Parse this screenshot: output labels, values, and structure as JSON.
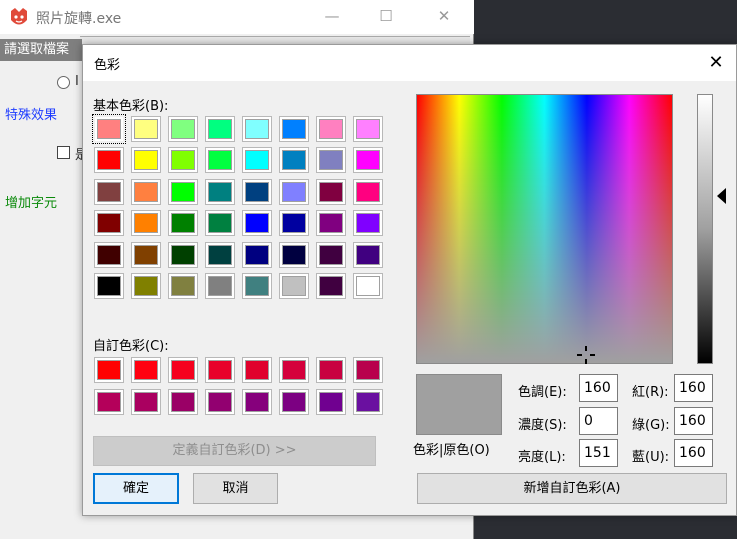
{
  "app": {
    "title": "照片旋轉.exe",
    "browse_label": "請選取檔案",
    "special_effects_label": "特殊效果",
    "add_text_label": "增加字元",
    "radio_label_partial": "I",
    "checkbox_label_partial": "是"
  },
  "dialog": {
    "title": "色彩",
    "basic_colors_label": "基本色彩(B):",
    "custom_colors_label": "自訂色彩(C):",
    "define_custom_button": "定義自訂色彩(D) >>",
    "ok_button": "確定",
    "cancel_button": "取消",
    "add_custom_button": "新增自訂色彩(A)",
    "preview_label": "色彩|原色(O)",
    "hue_label": "色調(E):",
    "hue_value": "160",
    "sat_label": "濃度(S):",
    "sat_value": "0",
    "lum_label": "亮度(L):",
    "lum_value": "151",
    "red_label": "紅(R):",
    "red_value": "160",
    "green_label": "綠(G):",
    "green_value": "160",
    "blue_label": "藍(U):",
    "blue_value": "160",
    "preview_color": "#a0a0a0"
  },
  "basic_colors": [
    "#ff8080",
    "#ffff80",
    "#80ff80",
    "#00ff80",
    "#80ffff",
    "#0080ff",
    "#ff80c0",
    "#ff80ff",
    "#ff0000",
    "#ffff00",
    "#80ff00",
    "#00ff40",
    "#00ffff",
    "#0080c0",
    "#8080c0",
    "#ff00ff",
    "#804040",
    "#ff8040",
    "#00ff00",
    "#008080",
    "#004080",
    "#8080ff",
    "#800040",
    "#ff0080",
    "#800000",
    "#ff8000",
    "#008000",
    "#008040",
    "#0000ff",
    "#0000a0",
    "#800080",
    "#8000ff",
    "#400000",
    "#804000",
    "#004000",
    "#004040",
    "#000080",
    "#000040",
    "#400040",
    "#400080",
    "#000000",
    "#808000",
    "#808040",
    "#808080",
    "#408080",
    "#c0c0c0",
    "#400040",
    "#ffffff"
  ],
  "custom_colors": [
    "#ff0000",
    "#ff0010",
    "#f5001e",
    "#e8002a",
    "#e0002c",
    "#d4003c",
    "#c80040",
    "#b8004c",
    "#b4005a",
    "#aa0060",
    "#9a0066",
    "#920070",
    "#86007c",
    "#7c0082",
    "#700090",
    "#6a10a0"
  ]
}
